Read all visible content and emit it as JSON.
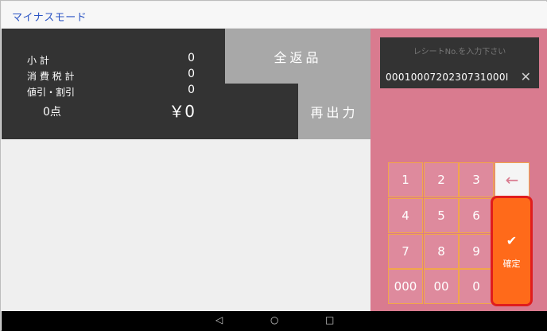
{
  "header": {
    "title": "マイナスモード"
  },
  "summary": {
    "rows": [
      {
        "label": "小 計",
        "value": "0"
      },
      {
        "label": "消 費 税 計",
        "value": "0"
      },
      {
        "label": "値引・割引",
        "value": "0"
      }
    ],
    "count": "0点",
    "total": "￥0"
  },
  "actions": {
    "all_return": "全返品",
    "reprint": "再出力"
  },
  "receipt": {
    "placeholder": "レシートNo.を入力下さい",
    "value": "0001000720230731000I",
    "clear_icon": "✕"
  },
  "keypad": {
    "keys": [
      "1",
      "2",
      "3",
      "4",
      "5",
      "6",
      "7",
      "8",
      "9",
      "000",
      "00",
      "0"
    ],
    "backspace_icon": "←"
  },
  "confirm": {
    "check_icon": "✔",
    "label": "確定"
  },
  "navbar": {
    "back_icon": "◁",
    "home_icon": "○",
    "recents_icon": "□"
  },
  "colors": {
    "accent": "#d97b8f",
    "confirm": "#ff6a1a",
    "highlight": "#e01d1d",
    "dark": "#333333"
  }
}
